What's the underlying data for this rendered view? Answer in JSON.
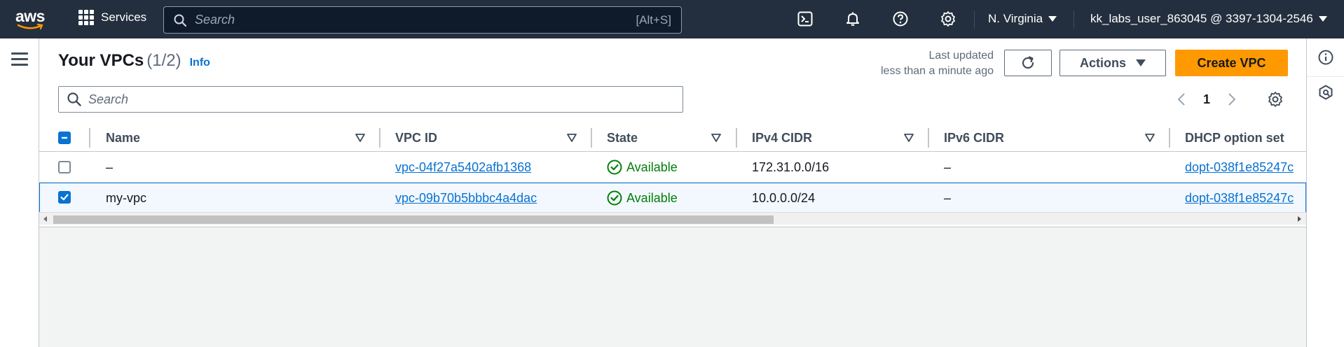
{
  "topnav": {
    "logo_text": "aws",
    "services_label": "Services",
    "search_placeholder": "Search",
    "search_shortcut": "[Alt+S]",
    "icons": [
      "cloudshell-icon",
      "bell-icon",
      "help-icon",
      "settings-icon"
    ],
    "region": "N. Virginia",
    "account": "kk_labs_user_863045 @ 3397-1304-2546"
  },
  "page": {
    "title": "Your VPCs",
    "count": "(1/2)",
    "info_link": "Info",
    "last_updated_line1": "Last updated",
    "last_updated_line2": "less than a minute ago",
    "actions_label": "Actions",
    "create_label": "Create VPC",
    "filter_placeholder": "Search",
    "current_page": "1"
  },
  "table": {
    "columns": [
      "Name",
      "VPC ID",
      "State",
      "IPv4 CIDR",
      "IPv6 CIDR",
      "DHCP option set"
    ],
    "rows": [
      {
        "selected": false,
        "name": "–",
        "vpc_id": "vpc-04f27a5402afb1368",
        "state": "Available",
        "ipv4": "172.31.0.0/16",
        "ipv6": "–",
        "dhcp": "dopt-038f1e85247c"
      },
      {
        "selected": true,
        "name": "my-vpc",
        "vpc_id": "vpc-09b70b5bbbc4a4dac",
        "state": "Available",
        "ipv4": "10.0.0.0/24",
        "ipv6": "–",
        "dhcp": "dopt-038f1e85247c"
      }
    ]
  },
  "colors": {
    "nav_bg": "#232f3e",
    "primary_orange": "#ff9900",
    "link_blue": "#0972d3",
    "success_green": "#037f0c"
  }
}
